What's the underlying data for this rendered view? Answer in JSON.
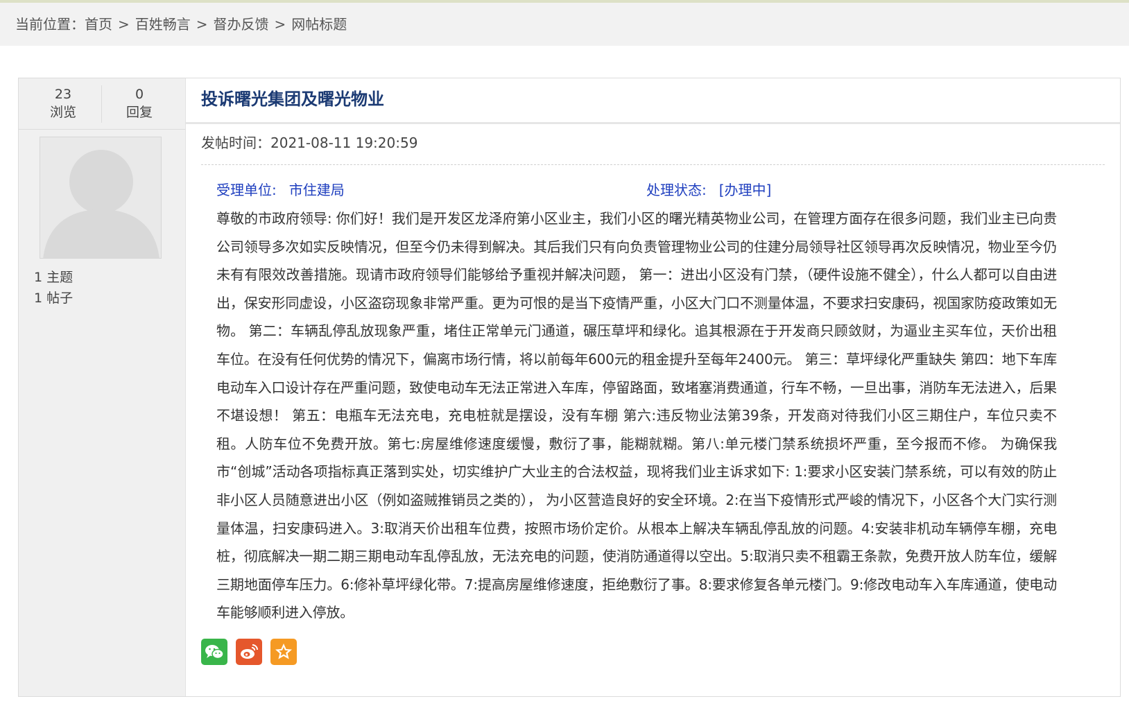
{
  "breadcrumb": {
    "prefix": "当前位置：",
    "items": [
      "首页",
      "百姓畅言",
      "督办反馈",
      "网帖标题"
    ],
    "separator": ">"
  },
  "stats": {
    "views_count": "23",
    "views_label": "浏览",
    "replies_count": "0",
    "replies_label": "回复"
  },
  "author": {
    "topics": "1 主题",
    "posts": "1 帖子"
  },
  "post": {
    "title": "投诉曙光集团及曙光物业",
    "time_label": "发帖时间：",
    "time_value": "2021-08-11 19:20:59",
    "unit_label": "受理单位:",
    "unit_value": "市住建局",
    "status_label": "处理状态:",
    "status_value": "[办理中]",
    "body": "尊敬的市政府领导: 你们好！我们是开发区龙泽府第小区业主，我们小区的曙光精英物业公司，在管理方面存在很多问题，我们业主已向贵公司领导多次如实反映情况，但至今仍未得到解决。其后我们只有向负责管理物业公司的住建分局领导社区领导再次反映情况，物业至今仍未有有限效改善措施。现请市政府领导们能够给予重视并解决问题， 第一：进出小区没有门禁，（硬件设施不健全），什么人都可以自由进出，保安形同虚设，小区盗窃现象非常严重。更为可恨的是当下疫情严重，小区大门口不测量体温，不要求扫安康码，视国家防疫政策如无物。 第二：车辆乱停乱放现象严重，堵住正常单元门通道，碾压草坪和绿化。追其根源在于开发商只顾敛财，为逼业主买车位，天价出租车位。在没有任何优势的情况下，偏离市场行情，将以前每年600元的租金提升至每年2400元。 第三：草坪绿化严重缺失 第四：地下车库电动车入口设计存在严重问题，致使电动车无法正常进入车库，停留路面，致堵塞消费通道，行车不畅，一旦出事，消防车无法进入，后果不堪设想！ 第五：电瓶车无法充电，充电桩就是摆设，没有车棚 第六:违反物业法第39条，开发商对待我们小区三期住户，车位只卖不租。人防车位不免费开放。第七:房屋维修速度缓慢，敷衍了事，能糊就糊。第八:单元楼门禁系统损坏严重，至今报而不修。 为确保我市“创城”活动各项指标真正落到实处，切实维护广大业主的合法权益，现将我们业主诉求如下: 1:要求小区安装门禁系统，可以有效的防止非小区人员随意进出小区（例如盗贼推销员之类的）， 为小区营造良好的安全环境。2:在当下疫情形式严峻的情况下，小区各个大门实行测量体温，扫安康码进入。3:取消天价出租车位费，按照市场价定价。从根本上解决车辆乱停乱放的问题。4:安装非机动车辆停车棚，充电桩，彻底解决一期二期三期电动车乱停乱放，无法充电的问题，使消防通道得以空出。5:取消只卖不租霸王条款，免费开放人防车位，缓解三期地面停车压力。6:修补草坪绿化带。7:提高房屋维修速度，拒绝敷衍了事。8:要求修复各单元楼门。9:修改电动车入车库通道，使电动车能够顺利进入停放。"
  },
  "share": {
    "icons": [
      "wechat-icon",
      "weibo-icon",
      "favorite-star-icon"
    ],
    "colors": {
      "wechat": "#39b54a",
      "weibo": "#e5572c",
      "favorite": "#f59a23"
    }
  },
  "colors": {
    "title": "#1b3a73",
    "meta_blue": "#1f3fbf",
    "sidebar_bg": "#f0f0f0",
    "breadcrumb_bg": "#f2f2f2"
  }
}
